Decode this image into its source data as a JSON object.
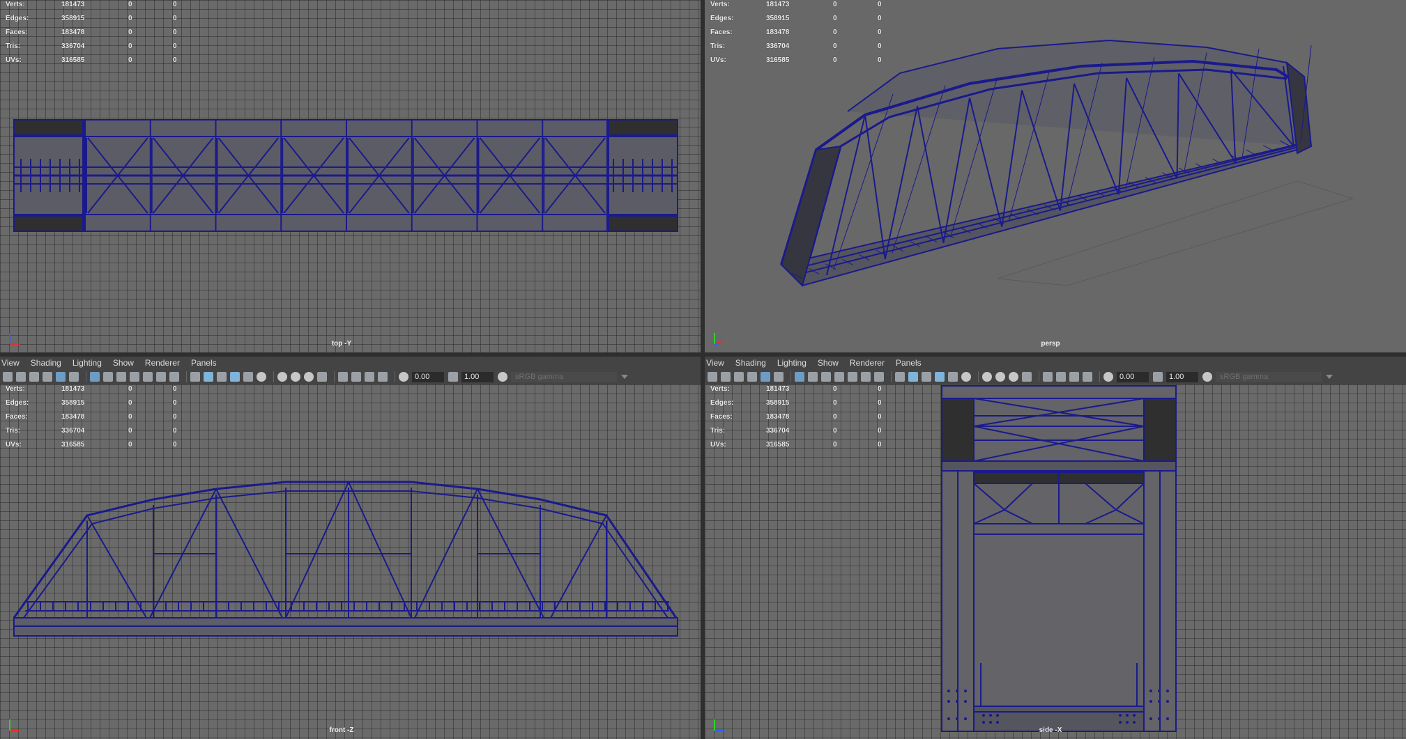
{
  "menus": {
    "view": "View",
    "shading": "Shading",
    "lighting": "Lighting",
    "show": "Show",
    "renderer": "Renderer",
    "panels": "Panels"
  },
  "toolbar": {
    "exposure": "0.00",
    "gamma": "1.00",
    "colorspace": "sRGB gamma"
  },
  "stats": {
    "labels": [
      "Verts:",
      "Edges:",
      "Faces:",
      "Tris:",
      "UVs:"
    ],
    "values": [
      "181473",
      "358915",
      "183478",
      "336704",
      "316585"
    ],
    "zero": "0"
  },
  "viewports": {
    "top": "top -Y",
    "persp": "persp",
    "front": "front -Z",
    "side": "side -X"
  },
  "colors": {
    "wire": "#1a1a8c",
    "bg": "#6a6a6a",
    "grid": "#555555",
    "dark": "#2f2f2f",
    "axisX": "#e03030",
    "axisY": "#30d030",
    "axisZ": "#3060ff"
  },
  "icons": [
    "camera-icon",
    "grid-icon",
    "shaded-icon",
    "wireframe-icon",
    "light-icon",
    "isolate-icon",
    "xray-icon",
    "exposure-icon",
    "gamma-icon"
  ]
}
